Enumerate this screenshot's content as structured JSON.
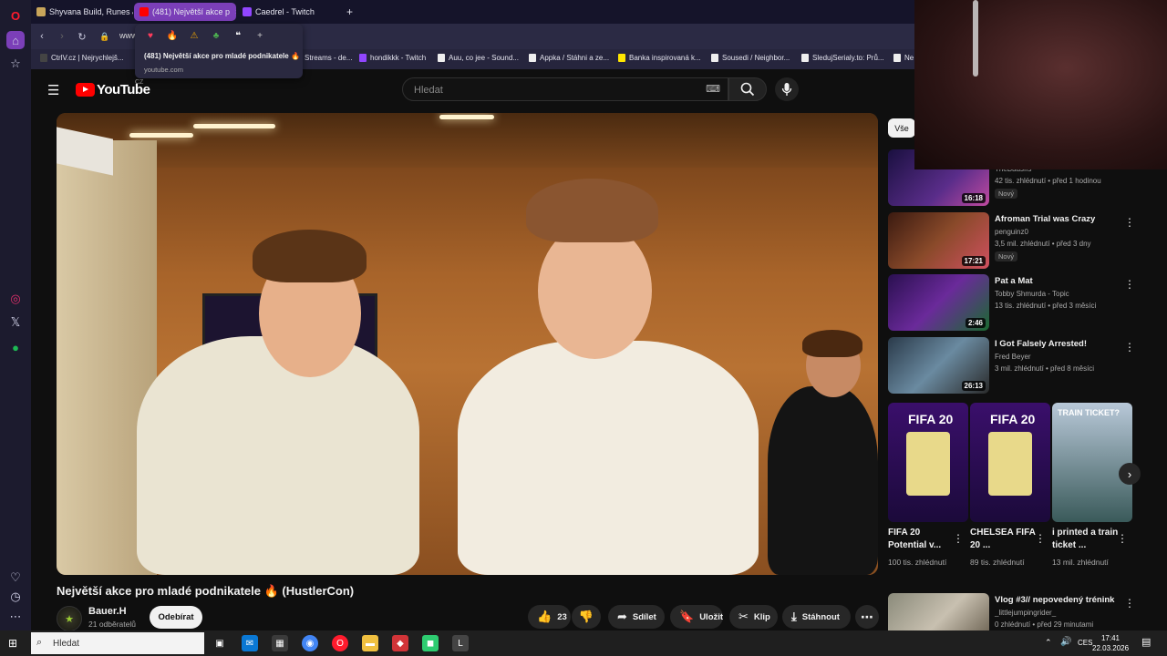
{
  "browser": {
    "tabs": [
      {
        "label": "Shyvana Build, Runes & C",
        "favicon_color": "#c8a55a"
      },
      {
        "label": "(481) Největší akce p",
        "favicon_color": "#ff0000"
      },
      {
        "label": "Caedrel - Twitch",
        "favicon_color": "#9146ff"
      }
    ],
    "new_tab_icon": "plus-icon",
    "url_text": "www",
    "popup": {
      "title": "(481) Největší akce pro mladé podnikatele 🔥",
      "url": "youtube.com",
      "icons": [
        "heart-icon",
        "fire-icon",
        "warning-icon",
        "palm-icon",
        "quote-icon",
        "plus-icon"
      ]
    },
    "bookmarks": [
      "CtrlV.cz | Nejrychlejš...",
      "Streams - de...",
      "hondikkk - Twitch",
      "Auu, co jee - Sound...",
      "Appka / Stáhni a ze...",
      "Banka inspirovaná k...",
      "Sousedi / Neighbor...",
      "SledujSerialy.to: Prů...",
      "Ne"
    ]
  },
  "youtube": {
    "logo_text": "YouTube",
    "country": "CZ",
    "search_placeholder": "Hledat",
    "video": {
      "title": "Největší akce pro mladé podnikatele 🔥 (HustlerCon)",
      "channel": "Bauer.H",
      "subscribers": "21 odběratelů",
      "subscribe_label": "Odebírat",
      "likes": "23",
      "share_label": "Sdílet",
      "save_label": "Uložit",
      "clip_label": "Klip",
      "download_label": "Stáhnout"
    },
    "filter_chip": "Vše",
    "recommendations": [
      {
        "title": "",
        "channel": "TheBausffs",
        "meta": "42 tis. zhlédnutí • před 1 hodinou",
        "badge": "Nový",
        "duration": "16:18"
      },
      {
        "title": "Afroman Trial was Crazy",
        "channel": "penguinz0",
        "meta": "3,5 mil. zhlédnutí • před 3 dny",
        "badge": "Nový",
        "duration": "17:21"
      },
      {
        "title": "Pat a Mat",
        "channel": "Tobby Shmurda - Topic",
        "meta": "13 tis. zhlédnutí • před 3 měsíci",
        "badge": "",
        "duration": "2:46"
      },
      {
        "title": "I Got Falsely Arrested!",
        "channel": "Fred Beyer",
        "meta": "3 mil. zhlédnutí • před 8 měsíci",
        "badge": "",
        "duration": "26:13"
      }
    ],
    "shorts": [
      {
        "title": "FIFA 20 Potential v...",
        "views": "100 tis. zhlédnutí",
        "overlay": "FIFA 20"
      },
      {
        "title": "CHELSEA FIFA 20 ...",
        "views": "89 tis. zhlédnutí",
        "overlay": "FIFA 20"
      },
      {
        "title": "i printed a train ticket ...",
        "views": "13 mil. zhlédnutí",
        "overlay": "TRAIN TICKET?"
      }
    ],
    "bottom_rec": {
      "title": "Vlog #3// nepovedený trénink",
      "channel": "_littlejumpingrider_",
      "meta": "0 zhlédnutí • před 29 minutami"
    }
  },
  "taskbar": {
    "search_placeholder": "Hledat",
    "language": "CES",
    "time": "17:41",
    "date": "22.03.2026"
  }
}
